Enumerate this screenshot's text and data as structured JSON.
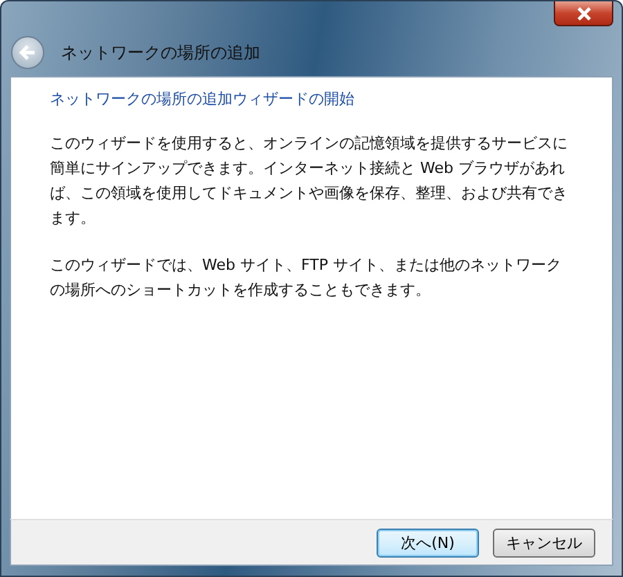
{
  "window": {
    "title": "ネットワークの場所の追加"
  },
  "heading": "ネットワークの場所の追加ウィザードの開始",
  "paragraphs": [
    "このウィザードを使用すると、オンラインの記憶領域を提供するサービスに簡単にサインアップできます。インターネット接続と Web ブラウザがあれば、この領域を使用してドキュメントや画像を保存、整理、および共有できます。",
    "このウィザードでは、Web サイト、FTP サイト、または他のネットワークの場所へのショートカットを作成することもできます。"
  ],
  "buttons": [
    {
      "label": "次へ(N)",
      "default": true
    },
    {
      "label": "キャンセル",
      "default": false
    }
  ]
}
